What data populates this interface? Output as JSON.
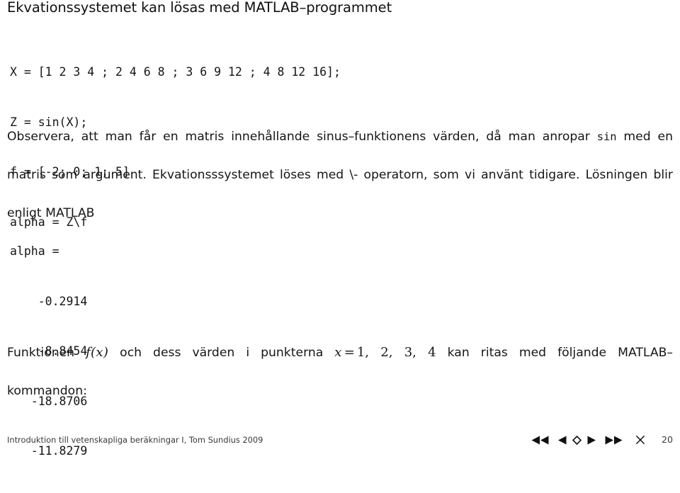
{
  "slide": {
    "title": "Ekvationssystemet kan lösas med MATLAB–programmet",
    "code_program": {
      "lines": [
        "X = [1 2 3 4 ; 2 4 6 8 ; 3 6 9 12 ; 4 8 12 16];",
        "Z = sin(X);",
        "f = [-2; 0; 1; 5]",
        "alpha = Z\\f"
      ]
    },
    "paragraph_observera": {
      "line1_a": "Observera, att man får en matris innehållande sinus–funktionens värden, då man anropar ",
      "line1_code": "sin",
      "line1_b": " med en",
      "line2": "matris som argument. Ekvationsssystemet löses med \\- operatorn, som vi använt tidigare. Lösningen blir",
      "line3": "enligt MATLAB"
    },
    "code_output": {
      "lines": [
        "alpha =",
        "    -0.2914",
        "    -8.8454",
        "   -18.8706",
        "   -11.8279"
      ]
    },
    "paragraph_funktionen": {
      "part1": "Funktionen ",
      "math_fx": "f(x)",
      "part2": " och dess värden i punkterna ",
      "math_x": "x",
      "math_eq": "=",
      "math_values": "1, 2, 3, 4",
      "part3": " kan ritas med följande MATLAB–",
      "line2": "kommandon:"
    }
  },
  "footer": {
    "left_text": "Introduktion till vetenskapliga beräkningar I, Tom Sundius 2009",
    "frame_number": "20",
    "nav": [
      {
        "name": "first-slide",
        "icon": "double-left-triangle-icon"
      },
      {
        "name": "previous-slide",
        "icon": "left-triangle-icon"
      },
      {
        "name": "current-slide",
        "icon": "diamond-outline-icon"
      },
      {
        "name": "next-slide",
        "icon": "right-triangle-icon"
      },
      {
        "name": "last-slide",
        "icon": "double-right-triangle-icon"
      },
      {
        "name": "close-presentation",
        "icon": "close-x-icon"
      }
    ]
  },
  "colors": {
    "text": "#1a1a1a",
    "footer_text": "#3a3a3a",
    "background": "#ffffff"
  }
}
